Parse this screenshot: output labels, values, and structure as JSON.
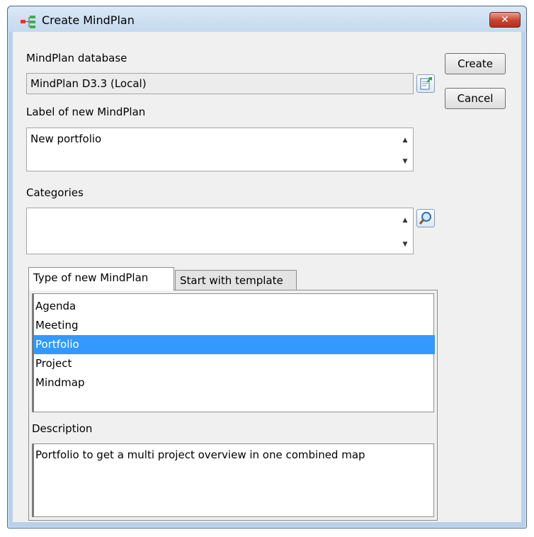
{
  "window": {
    "title": "Create MindPlan",
    "close_label": "✕"
  },
  "buttons": {
    "create": "Create",
    "cancel": "Cancel"
  },
  "database": {
    "label": "MindPlan database",
    "value": "MindPlan D3.3 (Local)"
  },
  "label_field": {
    "label": "Label of new MindPlan",
    "value": "New portfolio"
  },
  "categories": {
    "label": "Categories",
    "value": ""
  },
  "tabs": [
    {
      "label": "Type of new MindPlan",
      "active": true
    },
    {
      "label": "Start with template",
      "active": false
    }
  ],
  "types": [
    {
      "label": "Agenda",
      "selected": false
    },
    {
      "label": "Meeting",
      "selected": false
    },
    {
      "label": "Portfolio",
      "selected": true
    },
    {
      "label": "Project",
      "selected": false
    },
    {
      "label": "Mindmap",
      "selected": false
    }
  ],
  "description": {
    "label": "Description",
    "text": "Portfolio to get a multi project overview in one combined map"
  },
  "colors": {
    "selection": "#3399ff",
    "titlebar": "#c4d9ef",
    "close": "#c8422f"
  }
}
